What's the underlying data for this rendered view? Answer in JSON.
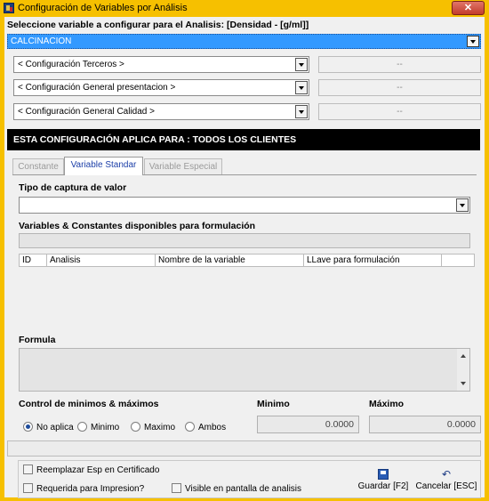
{
  "window": {
    "title": "Configuración de Variables por Análisis",
    "close_label": "✕"
  },
  "header": {
    "select_variable_label": "Seleccione variable a configurar para el Analisis: [Densidad - [g/ml]]",
    "process_value": "CALCINACION"
  },
  "configs": [
    {
      "value": "< Configuración Terceros >",
      "detail": "--"
    },
    {
      "value": "< Configuración General presentacion >",
      "detail": "--"
    },
    {
      "value": "< Configuración General Calidad >",
      "detail": "--"
    }
  ],
  "banner": "ESTA CONFIGURACIÓN APLICA PARA : TODOS LOS CLIENTES",
  "tabs": [
    {
      "label": "Constante",
      "active": false
    },
    {
      "label": "Variable Standar",
      "active": true
    },
    {
      "label": "Variable Especial",
      "active": false
    }
  ],
  "capture": {
    "label": "Tipo de captura de valor",
    "value": ""
  },
  "variables": {
    "label": "Variables & Constantes disponibles para formulación",
    "columns": [
      "ID",
      "Analisis",
      "Nombre de la variable",
      "LLave para formulación"
    ]
  },
  "formula": {
    "label": "Formula"
  },
  "control": {
    "label": "Control de minimos & máximos",
    "min_label": "Minimo",
    "max_label": "Máximo",
    "options": [
      "No aplica",
      "Minimo",
      "Maximo",
      "Ambos"
    ],
    "selected": "No aplica",
    "min_value": "0.0000",
    "max_value": "0.0000"
  },
  "footer": {
    "replace_esp": "Reemplazar Esp en Certificado",
    "required_print": "Requerida para Impresion?",
    "visible_screen": "Visible en pantalla de analisis",
    "save_label": "Guardar [F2]",
    "cancel_label": "Cancelar [ESC]"
  },
  "colors": {
    "window_border": "#f6c000",
    "selected_row": "#3399ff",
    "banner_bg": "#000000",
    "active_tab_text": "#1c3fa8"
  }
}
